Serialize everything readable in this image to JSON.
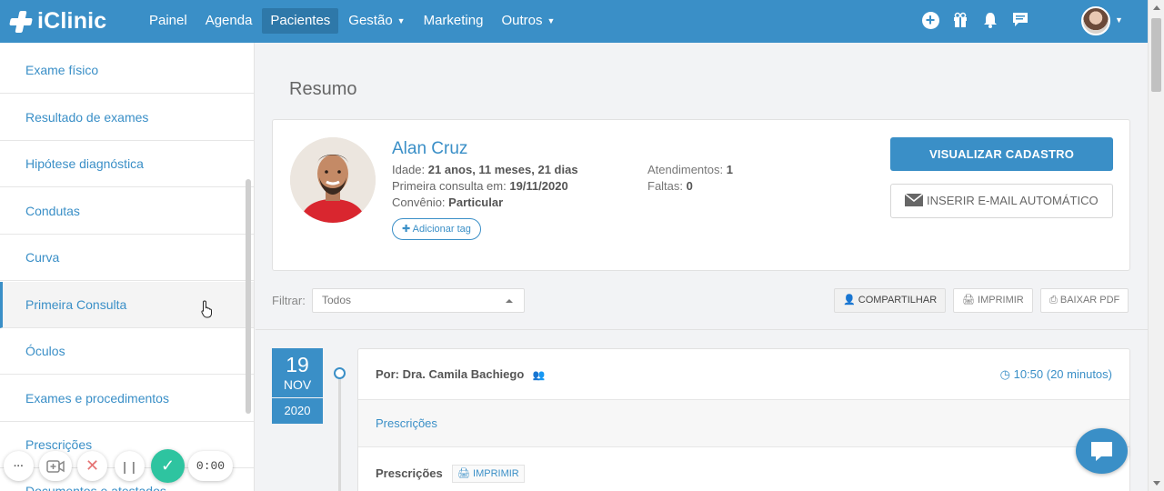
{
  "brand": {
    "name": "iClinic"
  },
  "nav": {
    "items": [
      {
        "label": "Painel",
        "has_dropdown": false,
        "active": false
      },
      {
        "label": "Agenda",
        "has_dropdown": false,
        "active": false
      },
      {
        "label": "Pacientes",
        "has_dropdown": false,
        "active": true
      },
      {
        "label": "Gestão",
        "has_dropdown": true,
        "active": false
      },
      {
        "label": "Marketing",
        "has_dropdown": false,
        "active": false
      },
      {
        "label": "Outros",
        "has_dropdown": true,
        "active": false
      }
    ],
    "icons": [
      "plus-circle-icon",
      "gift-icon",
      "bell-icon",
      "chat-icon"
    ]
  },
  "sidebar": {
    "items": [
      {
        "label": "Exame físico",
        "active": false
      },
      {
        "label": "Resultado de exames",
        "active": false
      },
      {
        "label": "Hipótese diagnóstica",
        "active": false
      },
      {
        "label": "Condutas",
        "active": false
      },
      {
        "label": "Curva",
        "active": false
      },
      {
        "label": "Primeira Consulta",
        "active": true
      },
      {
        "label": "Óculos",
        "active": false
      },
      {
        "label": "Exames e procedimentos",
        "active": false
      },
      {
        "label": "Prescrições",
        "active": false
      },
      {
        "label": "Documentos e atestados",
        "active": false
      }
    ]
  },
  "main": {
    "title": "Resumo",
    "patient": {
      "name": "Alan Cruz",
      "age_label": "Idade:",
      "age_value": "21 anos, 11 meses, 21 dias",
      "first_label": "Primeira consulta em:",
      "first_value": "19/11/2020",
      "insurance_label": "Convênio:",
      "insurance_value": "Particular",
      "tag_button": "Adicionar tag",
      "visits_label": "Atendimentos:",
      "visits_value": "1",
      "absences_label": "Faltas:",
      "absences_value": "0",
      "view_button": "VISUALIZAR CADASTRO",
      "email_button": "INSERIR E-MAIL AUTOMÁTICO"
    },
    "filter": {
      "label": "Filtrar:",
      "value": "Todos"
    },
    "toolbar": {
      "share": "COMPARTILHAR",
      "print": "IMPRIMIR",
      "pdf": "BAIXAR PDF"
    },
    "timeline": {
      "day": "19",
      "month": "NOV",
      "year": "2020",
      "author": "Por: Dra. Camila Bachiego",
      "time": "10:50 (20 minutos)",
      "section": "Prescrições",
      "body_title": "Prescrições",
      "print_label": "IMPRIMIR"
    }
  },
  "recorder": {
    "timer": "0:00"
  },
  "colors": {
    "brand": "#3a8fc7",
    "success": "#2ec4a0"
  }
}
